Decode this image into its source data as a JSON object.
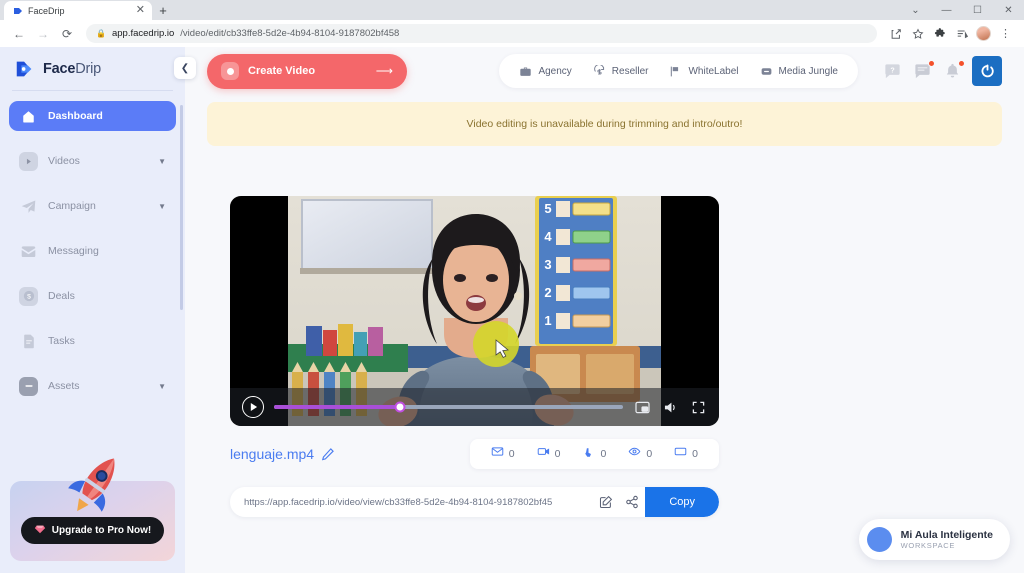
{
  "browser": {
    "tab": {
      "title": "FaceDrip",
      "favicon_icon": "facedrip-favicon",
      "close_icon": "close-icon"
    },
    "new_tab_icon": "plus-icon",
    "window_controls": {
      "more_icon": "chevron-down-icon",
      "minimize_icon": "minimize-icon",
      "maximize_icon": "maximize-icon",
      "close_icon": "close-icon"
    },
    "nav": {
      "back_icon": "back-arrow-icon",
      "forward_icon": "forward-arrow-icon",
      "reload_icon": "reload-icon"
    },
    "omnibox": {
      "lock_icon": "lock-icon",
      "host": "app.facedrip.io",
      "path": "/video/edit/cb33ffe8-5d2e-4b94-8104-9187802bf458",
      "full_url": "app.facedrip.io/video/edit/cb33ffe8-5d2e-4b94-8104-9187802bf458"
    },
    "toolbar_icons": [
      "share-icon",
      "bookmark-star-icon",
      "extensions-puzzle-icon",
      "reading-list-icon",
      "profile-avatar",
      "more-vertical-icon"
    ]
  },
  "sidebar": {
    "brand": {
      "name": "Face",
      "suffix": "Drip",
      "logo_icon": "facedrip-logo"
    },
    "collapse_icon": "chevron-left-icon",
    "items": [
      {
        "label": "Dashboard",
        "icon": "home-icon",
        "active": true,
        "has_caret": false
      },
      {
        "label": "Videos",
        "icon": "video-play-icon",
        "active": false,
        "has_caret": true
      },
      {
        "label": "Campaign",
        "icon": "paper-plane-icon",
        "active": false,
        "has_caret": true
      },
      {
        "label": "Messaging",
        "icon": "envelope-icon",
        "active": false,
        "has_caret": false
      },
      {
        "label": "Deals",
        "icon": "dollar-coin-icon",
        "active": false,
        "has_caret": false
      },
      {
        "label": "Tasks",
        "icon": "document-list-icon",
        "active": false,
        "has_caret": false
      },
      {
        "label": "Assets",
        "icon": "folder-icon",
        "active": false,
        "has_caret": true
      }
    ],
    "promo": {
      "label": "Upgrade to Pro Now!",
      "icon": "diamond-gem-icon",
      "art": "rocket-illustration"
    },
    "active_color": "#5b7cf7",
    "background": "#e9edfa"
  },
  "topbar": {
    "create_button": {
      "label": "Create Video",
      "icon": "record-dot-icon",
      "arrow_icon": "arrow-right-icon",
      "color": "#f4676a"
    },
    "pills": [
      {
        "label": "Agency",
        "icon": "briefcase-icon"
      },
      {
        "label": "Reseller",
        "icon": "dollar-refresh-icon"
      },
      {
        "label": "WhiteLabel",
        "icon": "flag-icon"
      },
      {
        "label": "Media Jungle",
        "icon": "media-folder-icon"
      }
    ],
    "icons": [
      {
        "name": "help-question-icon",
        "badge": false
      },
      {
        "name": "chat-bubble-icon",
        "badge": true
      },
      {
        "name": "bell-notification-icon",
        "badge": true
      }
    ],
    "power_button": {
      "icon": "power-icon",
      "color": "#1b6ec2"
    },
    "badge_color": "#f4512c"
  },
  "alert": {
    "message": "Video editing is unavailable during trimming and intro/outro!",
    "background": "#fdf3d7",
    "text_color": "#8a7330"
  },
  "video": {
    "player": {
      "play_icon": "play-icon",
      "progress_percent": 36,
      "progress_color": "#a94fd8",
      "pip_icon": "picture-in-picture-icon",
      "volume_icon": "volume-icon",
      "fullscreen_icon": "fullscreen-icon",
      "cursor_highlight_color": "#d4d62a",
      "cursor_icon": "mouse-pointer-icon"
    },
    "filename": "lenguaje.mp4",
    "edit_icon": "pencil-icon",
    "stats": [
      {
        "icon": "envelope-icon",
        "value": "0"
      },
      {
        "icon": "video-camera-icon",
        "value": "0"
      },
      {
        "icon": "click-hand-icon",
        "value": "0"
      },
      {
        "icon": "eye-icon",
        "value": "0"
      },
      {
        "icon": "window-play-icon",
        "value": "0"
      }
    ],
    "share": {
      "url": "https://app.facedrip.io/video/view/cb33ffe8-5d2e-4b94-8104-9187802bf45",
      "edit_icon": "edit-square-icon",
      "share_icon": "share-nodes-icon",
      "copy_label": "Copy",
      "copy_color": "#1a73e8"
    }
  },
  "workspace": {
    "name": "Mi Aula Inteligente",
    "subtitle": "WORKSPACE",
    "avatar_icon": "workspace-avatar",
    "avatar_color": "#5b8def"
  }
}
